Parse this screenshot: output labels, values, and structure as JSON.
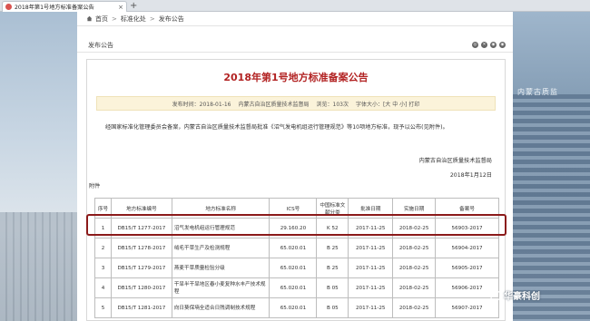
{
  "browser": {
    "tab_title": "2018年第1号地方标准备案公告",
    "close_glyph": "×",
    "new_tab_glyph": "+"
  },
  "breadcrumb": {
    "items": [
      "首页",
      "标准化处",
      "发布公告"
    ],
    "separator": ">"
  },
  "section": {
    "title": "发布公告",
    "tools": [
      "◎",
      "✕",
      "◉",
      "◉"
    ]
  },
  "notice": {
    "title": "2018年第1号地方标准备案公告",
    "meta": {
      "publish_time": "发布时间：2018-01-16",
      "source": "内蒙古自治区质量技术监督局",
      "views": "浏览：103次",
      "font_size": "字体大小：[大 中 小] 打印"
    },
    "body": "经国家标准化管理委员会备案，内蒙古自治区质量技术监督局批准《沼气发电机组运行管理规范》等10项地方标准，现予以公布(见附件)。",
    "sign_org": "内蒙古自治区质量技术监督局",
    "sign_date": "2018年1月12日",
    "attachment_label": "附件"
  },
  "table": {
    "headers": [
      "序号",
      "地方标准编号",
      "地方标准名称",
      "ICS号",
      "中国标准文献分类",
      "批准日期",
      "实施日期",
      "备案号"
    ],
    "rows": [
      [
        "1",
        "DB15/T 1277-2017",
        "沼气发电机组运行管理规范",
        "29.160.20",
        "K 52",
        "2017-11-25",
        "2018-02-25",
        "56903-2017"
      ],
      [
        "2",
        "DB15/T 1278-2017",
        "绒毛干草生产及检测规程",
        "65.020.01",
        "B 25",
        "2017-11-25",
        "2018-02-25",
        "56904-2017"
      ],
      [
        "3",
        "DB15/T 1279-2017",
        "燕麦干草质量检验分级",
        "65.020.01",
        "B 25",
        "2017-11-25",
        "2018-02-25",
        "56905-2017"
      ],
      [
        "4",
        "DB15/T 1280-2017",
        "干旱半干旱地区春小麦复种水丰产技术规程",
        "65.020.01",
        "B 05",
        "2017-11-25",
        "2018-02-25",
        "56906-2017"
      ],
      [
        "5",
        "DB15/T 1281-2017",
        "向日葵保墒全适合日残调制技术规程",
        "65.020.01",
        "B 05",
        "2017-11-25",
        "2018-02-25",
        "56907-2017"
      ]
    ]
  },
  "background": {
    "building_sign": "内蒙古质监"
  },
  "watermark": {
    "text": "华豪科创",
    "icon": "☺"
  },
  "colors": {
    "title_red": "#b22222",
    "highlight_border": "#8b1a1a",
    "meta_bg": "#fbf3da"
  }
}
